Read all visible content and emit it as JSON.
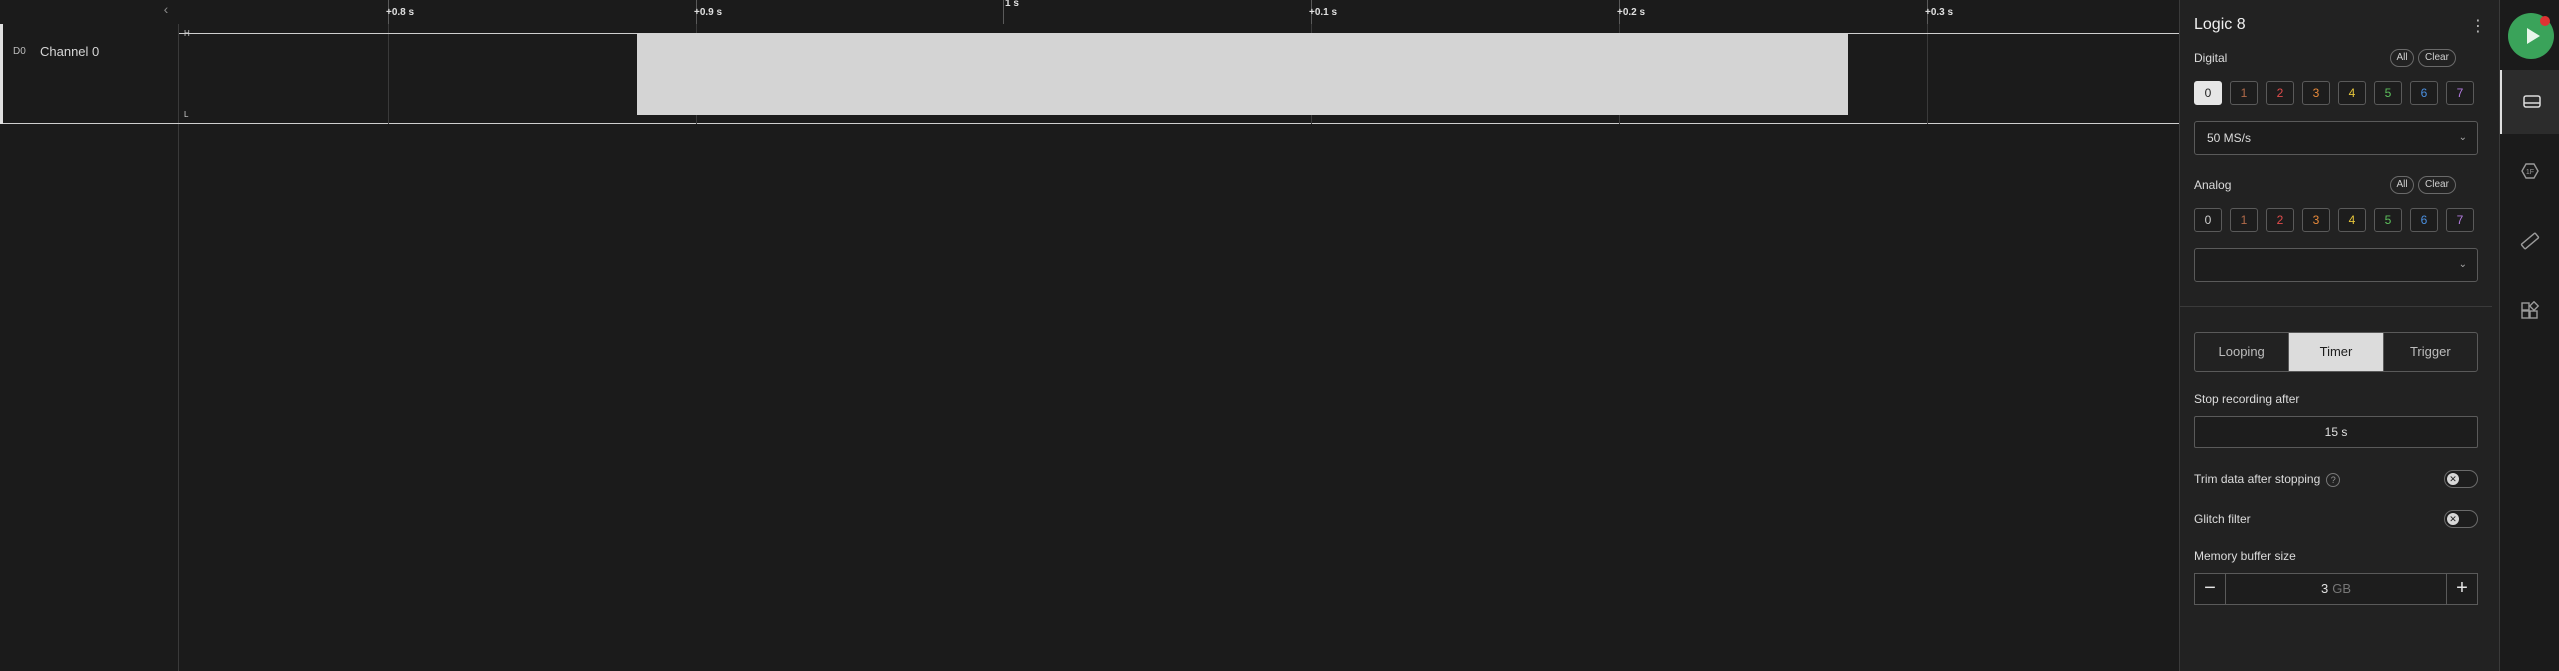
{
  "ruler": {
    "ticks": [
      "+0.8 s",
      "+0.9 s",
      "1 s",
      "+0.1 s",
      "+0.2 s",
      "+0.3 s"
    ]
  },
  "channels": [
    {
      "id": "D0",
      "name": "Channel 0"
    }
  ],
  "panel": {
    "device_name": "Logic 8",
    "digital": {
      "label": "Digital",
      "all_label": "All",
      "clear_label": "Clear",
      "channels": [
        "0",
        "1",
        "2",
        "3",
        "4",
        "5",
        "6",
        "7"
      ],
      "enabled": [
        "0"
      ],
      "sample_rate": "50 MS/s"
    },
    "analog": {
      "label": "Analog",
      "all_label": "All",
      "clear_label": "Clear",
      "channels": [
        "0",
        "1",
        "2",
        "3",
        "4",
        "5",
        "6",
        "7"
      ],
      "sample_rate": ""
    },
    "modes": {
      "looping": "Looping",
      "timer": "Timer",
      "trigger": "Trigger",
      "selected": "Timer"
    },
    "stop_recording": {
      "label": "Stop recording after",
      "value": "15 s"
    },
    "trim_data": {
      "label": "Trim data after stopping",
      "help": "?",
      "enabled": false
    },
    "glitch_filter": {
      "label": "Glitch filter",
      "enabled": false
    },
    "memory_buffer": {
      "label": "Memory buffer size",
      "value": "3",
      "unit": "GB",
      "decrement": "−",
      "increment": "+"
    }
  },
  "colors": {
    "channel_0": "#cfcfcf",
    "channel_1": "#b36b4a",
    "channel_2": "#e04b4b",
    "channel_3": "#e88a3a",
    "channel_4": "#e6c53a",
    "channel_5": "#5cbf5c",
    "channel_6": "#4a8fe0",
    "channel_7": "#b37ae0",
    "run_button": "#3aa35a"
  },
  "toolbar": {
    "icons": [
      "play-icon",
      "device-settings-icon",
      "analyzers-icon",
      "measurements-icon",
      "extensions-icon"
    ]
  }
}
